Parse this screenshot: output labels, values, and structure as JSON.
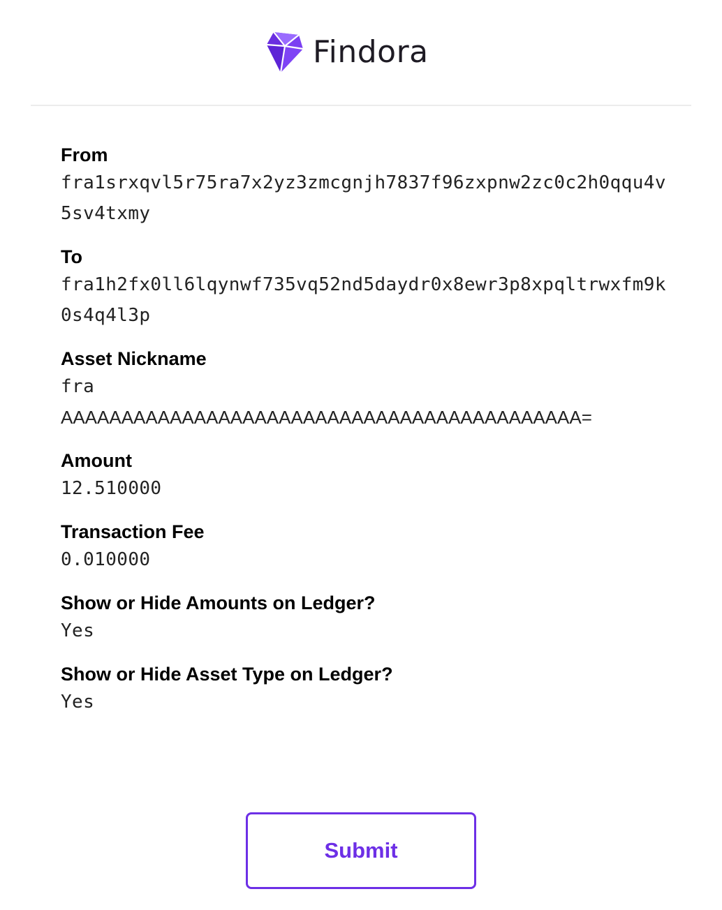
{
  "brand": {
    "name": "Findora",
    "accent_color": "#6d2fe6",
    "logo_icon": "findora-gem-icon"
  },
  "fields": {
    "from": {
      "label": "From",
      "value": "fra1srxqvl5r75ra7x2yz3zmcgnjh7837f96zxpnw2zc0c2h0qqu4v5sv4txmy"
    },
    "to": {
      "label": "To",
      "value": "fra1h2fx0ll6lqynwf735vq52nd5daydr0x8ewr3p8xpqltrwxfm9k0s4q4l3p"
    },
    "asset_nickname": {
      "label": "Asset Nickname",
      "value_line1": "fra",
      "value_line2": "AAAAAAAAAAAAAAAAAAAAAAAAAAAAAAAAAAAAAAAAAAA="
    },
    "amount": {
      "label": "Amount",
      "value": "12.510000"
    },
    "transaction_fee": {
      "label": "Transaction Fee",
      "value": "0.010000"
    },
    "show_amounts": {
      "label": "Show or Hide Amounts on Ledger?",
      "value": "Yes"
    },
    "show_asset_type": {
      "label": "Show or Hide Asset Type on Ledger?",
      "value": "Yes"
    }
  },
  "submit": {
    "label": "Submit"
  }
}
